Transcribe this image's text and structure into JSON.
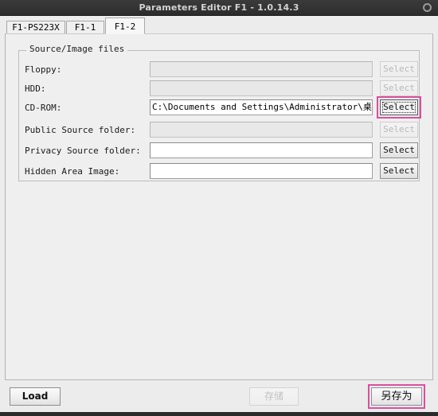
{
  "window": {
    "title": "Parameters Editor F1 - 1.0.14.3",
    "close_icon": "circle-icon"
  },
  "tabs": [
    {
      "label": "F1-PS223X",
      "selected": false
    },
    {
      "label": "F1-1",
      "selected": false
    },
    {
      "label": "F1-2",
      "selected": true
    }
  ],
  "group": {
    "legend": "Source/Image files",
    "rows": [
      {
        "label": "Floppy:",
        "value": "",
        "input_enabled": false,
        "button_label": "Select",
        "button_enabled": false,
        "button_focused": false,
        "highlighted": false
      },
      {
        "label": "HDD:",
        "value": "",
        "input_enabled": false,
        "button_label": "Select",
        "button_enabled": false,
        "button_focused": false,
        "highlighted": false
      },
      {
        "label": "CD-ROM:",
        "value": "C:\\Documents and Settings\\Administrator\\桌面\\Pooh",
        "input_enabled": true,
        "button_label": "Select",
        "button_enabled": true,
        "button_focused": true,
        "highlighted": true
      },
      {
        "label": "Public Source folder:",
        "value": "",
        "input_enabled": false,
        "button_label": "Select",
        "button_enabled": false,
        "button_focused": false,
        "highlighted": false
      },
      {
        "label": "Privacy Source folder:",
        "value": "",
        "input_enabled": true,
        "button_label": "Select",
        "button_enabled": true,
        "button_focused": false,
        "highlighted": false
      },
      {
        "label": "Hidden Area Image:",
        "value": "",
        "input_enabled": true,
        "button_label": "Select",
        "button_enabled": true,
        "button_focused": false,
        "highlighted": false
      }
    ]
  },
  "footer": {
    "load_label": "Load",
    "save_label": "存储",
    "save_enabled": false,
    "save_as_label": "另存为",
    "save_as_highlighted": true
  },
  "colors": {
    "highlight": "#d94fa0",
    "titlebar": "#333333",
    "panel": "#efefef"
  }
}
